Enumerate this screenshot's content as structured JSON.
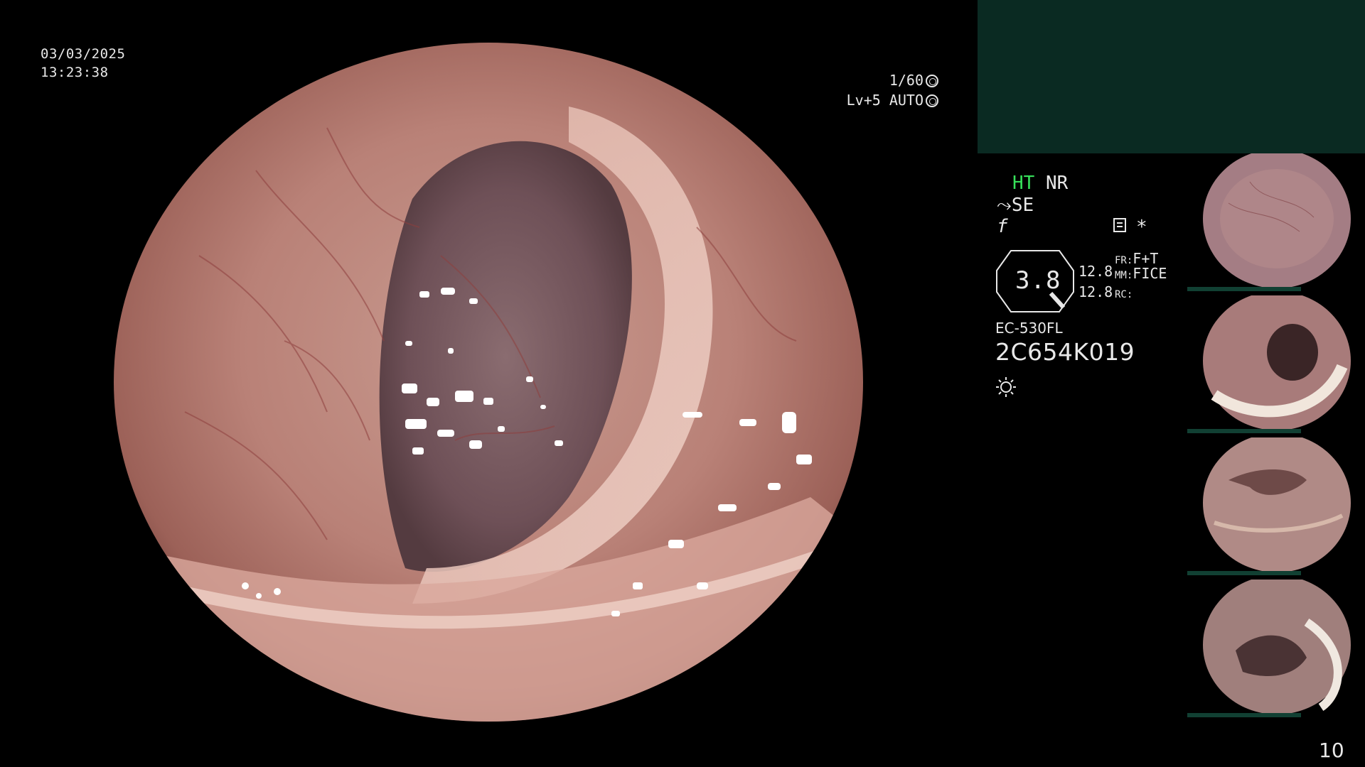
{
  "overlay": {
    "date": "03/03/2025",
    "time": "13:23:38",
    "shutter": "1/60",
    "level": "Lv+5",
    "mode": "AUTO"
  },
  "settings": {
    "ht": "HT",
    "nr": "NR",
    "se": "SE",
    "f_symbol": "f",
    "star": "*",
    "main_value": "3.8",
    "value1": "12.8",
    "value2": "12.8",
    "fr_label": "FR:",
    "fr_value": "F+T",
    "mm_label": "MM:",
    "mm_value": "FICE",
    "rc_label": "RC:"
  },
  "device": {
    "model": "EC-530FL",
    "serial": "2C654K019"
  },
  "thumbnails": [
    {
      "label": "thumbnail-1"
    },
    {
      "label": "thumbnail-2"
    },
    {
      "label": "thumbnail-3"
    },
    {
      "label": "thumbnail-4"
    }
  ],
  "page_number": "10",
  "colors": {
    "background": "#000000",
    "panel_green": "#0a2a22",
    "highlight_green": "#37e05a",
    "text": "#e8e8e8"
  }
}
